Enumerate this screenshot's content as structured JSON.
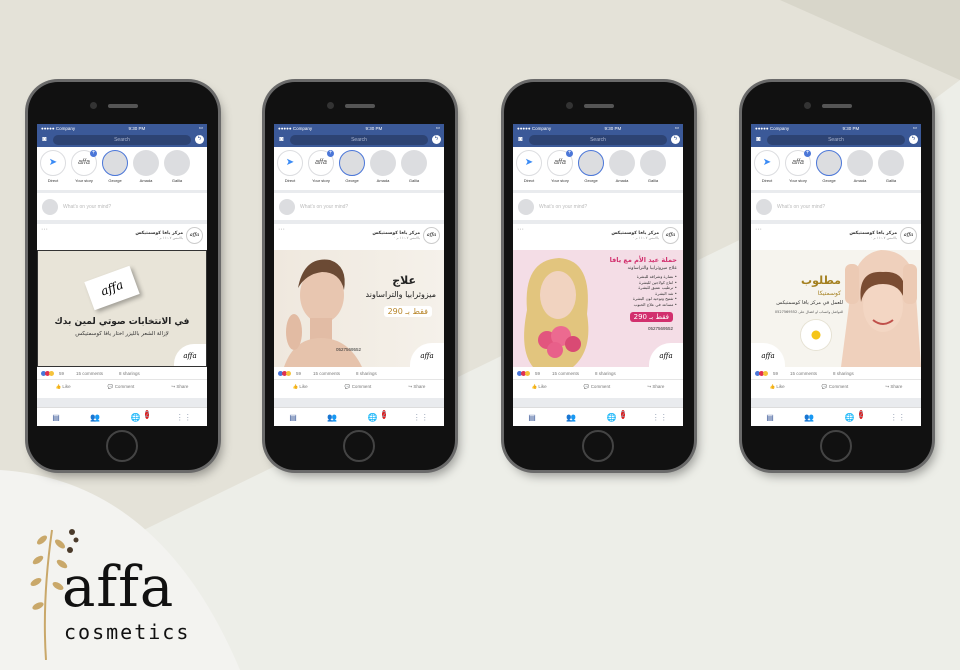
{
  "colors": {
    "fb_blue": "#3b5998",
    "bg": "#e4e2d8",
    "accent_pink": "#e24d8b"
  },
  "phones": [
    {
      "status": {
        "carrier": "●●●●● Company",
        "time": "9:30 PM"
      },
      "search_placeholder": "Search",
      "stories": [
        "Direct",
        "Your story",
        "George",
        "Amada",
        "Gallia"
      ],
      "compose_placeholder": "What's on your mind?",
      "page_name": "مركز يافا كوسمتيكس",
      "page_sub": "بالامس ١١:٠٧ م · ",
      "ad_line1": "في الانتخابات صوتي لمين بدك",
      "ad_line2": "لإزالة الشعر بالليزر اختار يافا كوسمتيكس",
      "card_logo": "affa",
      "reactions_count": "59",
      "comments": "15 comments",
      "shares": "8 sharings",
      "like": "Like",
      "comment": "Comment",
      "share": "Share",
      "notif_count": "2"
    },
    {
      "status": {
        "carrier": "●●●●● Company",
        "time": "9:30 PM"
      },
      "search_placeholder": "Search",
      "stories": [
        "Direct",
        "Your story",
        "George",
        "Amada",
        "Gallia"
      ],
      "compose_placeholder": "What's on your mind?",
      "page_name": "مركز يافا كوسمتيكس",
      "page_sub": "بالامس ١١:٠٧ م · ",
      "ad_title": "علاج",
      "ad_line1": "ميزوثرابيا والتراساوند",
      "ad_price": "فقط بـ 290",
      "phone_number": "0527569552",
      "reactions_count": "59",
      "comments": "15 comments",
      "shares": "8 sharings",
      "like": "Like",
      "comment": "Comment",
      "share": "Share",
      "notif_count": "2"
    },
    {
      "status": {
        "carrier": "●●●●● Company",
        "time": "9:30 PM"
      },
      "search_placeholder": "Search",
      "stories": [
        "Direct",
        "Your story",
        "George",
        "Amada",
        "Gallia"
      ],
      "compose_placeholder": "What's on your mind?",
      "page_name": "مركز يافا كوسمتيكس",
      "page_sub": "بالامس ١١:٠٧ م · ",
      "ad_title": "حملة عيد الأم مع يافا",
      "ad_line1": "علاج ميزوثرابيا والتراساوند",
      "ad_bullets": [
        "• نضارة وشراقة للبشرة",
        "• انتاج كولاجين للبشرة",
        "• ترطيب عميق للبشرة",
        "• شد البشرة",
        "• تفتيح وتوحيد لون البشرة",
        "• مساعد في علاج الحبوب"
      ],
      "ad_price": "فقط بـ 290",
      "phone_number": "0527569552",
      "reactions_count": "59",
      "comments": "15 comments",
      "shares": "8 sharings",
      "like": "Like",
      "comment": "Comment",
      "share": "Share",
      "notif_count": "2"
    },
    {
      "status": {
        "carrier": "●●●●● Company",
        "time": "9:30 PM"
      },
      "search_placeholder": "Search",
      "stories": [
        "Direct",
        "Your story",
        "George",
        "Amada",
        "Gallia"
      ],
      "compose_placeholder": "What's on your mind?",
      "page_name": "مركز يافا كوسمتيكس",
      "page_sub": "بالامس ١١:٠٧ م · ",
      "ad_title": "مطلوب",
      "ad_subtitle": "كوسمتيكا",
      "ad_line1": "للعمل في مركز يافا كوسمتيكس",
      "ad_line2": "للتواصل واتساب او اتصال على 0527569552",
      "reactions_count": "59",
      "comments": "15 comments",
      "shares": "8 sharings",
      "like": "Like",
      "comment": "Comment",
      "share": "Share",
      "notif_count": "2"
    }
  ],
  "brand": {
    "logo_word": "affa",
    "logo_sub": "cosmetics"
  }
}
